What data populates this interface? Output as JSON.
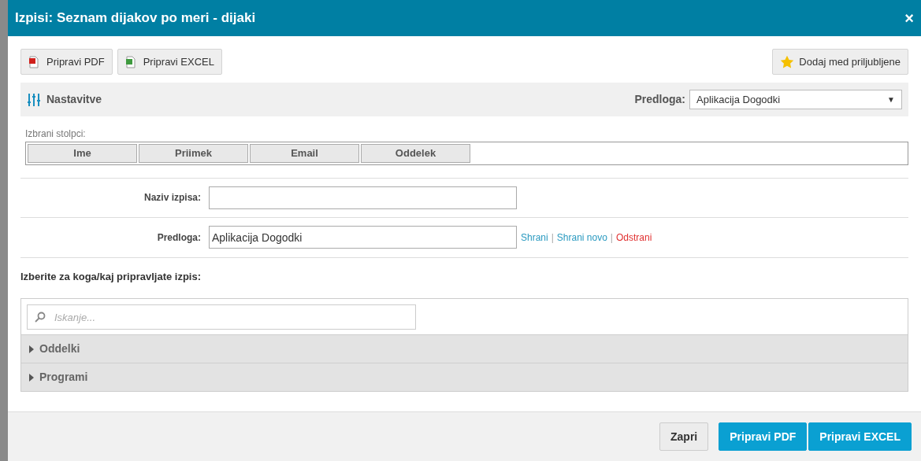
{
  "window": {
    "title": "Izpisi: Seznam dijakov po meri - dijaki",
    "close": "×"
  },
  "toolbar": {
    "buttons": [
      {
        "label": "Pripravi PDF",
        "kind": "pdf"
      },
      {
        "label": "Pripravi EXCEL",
        "kind": "excel"
      }
    ],
    "favorite": "Dodaj med priljubljene"
  },
  "settings": {
    "title": "Nastavitve",
    "template_label": "Predloga:",
    "template_value": "Aplikacija Dogodki",
    "caret": "▼"
  },
  "columns": {
    "label": "Izbrani stolpci:",
    "items": [
      "Ime",
      "Priimek",
      "Email",
      "Oddelek"
    ]
  },
  "form": {
    "name_label": "Naziv izpisa:",
    "template_label": "Predloga:",
    "template_value": "Aplikacija Dogodki",
    "separator": "|",
    "links": [
      {
        "label": "Shrani",
        "kind": "normal"
      },
      {
        "label": "Shrani novo",
        "kind": "normal"
      },
      {
        "label": "Odstrani",
        "kind": "danger"
      }
    ]
  },
  "selection": {
    "title": "Izberite za koga/kaj pripravljate izpis:",
    "placeholder": "Iskanje...",
    "tree": [
      {
        "label": "Oddelki",
        "expanded": false
      },
      {
        "label": "Programi",
        "expanded": false
      }
    ]
  },
  "footer": {
    "buttons": [
      {
        "label": "Zapri",
        "kind": "secondary"
      },
      {
        "label": "Pripravi PDF",
        "kind": "primary"
      },
      {
        "label": "Pripravi EXCEL",
        "kind": "primary"
      }
    ]
  }
}
